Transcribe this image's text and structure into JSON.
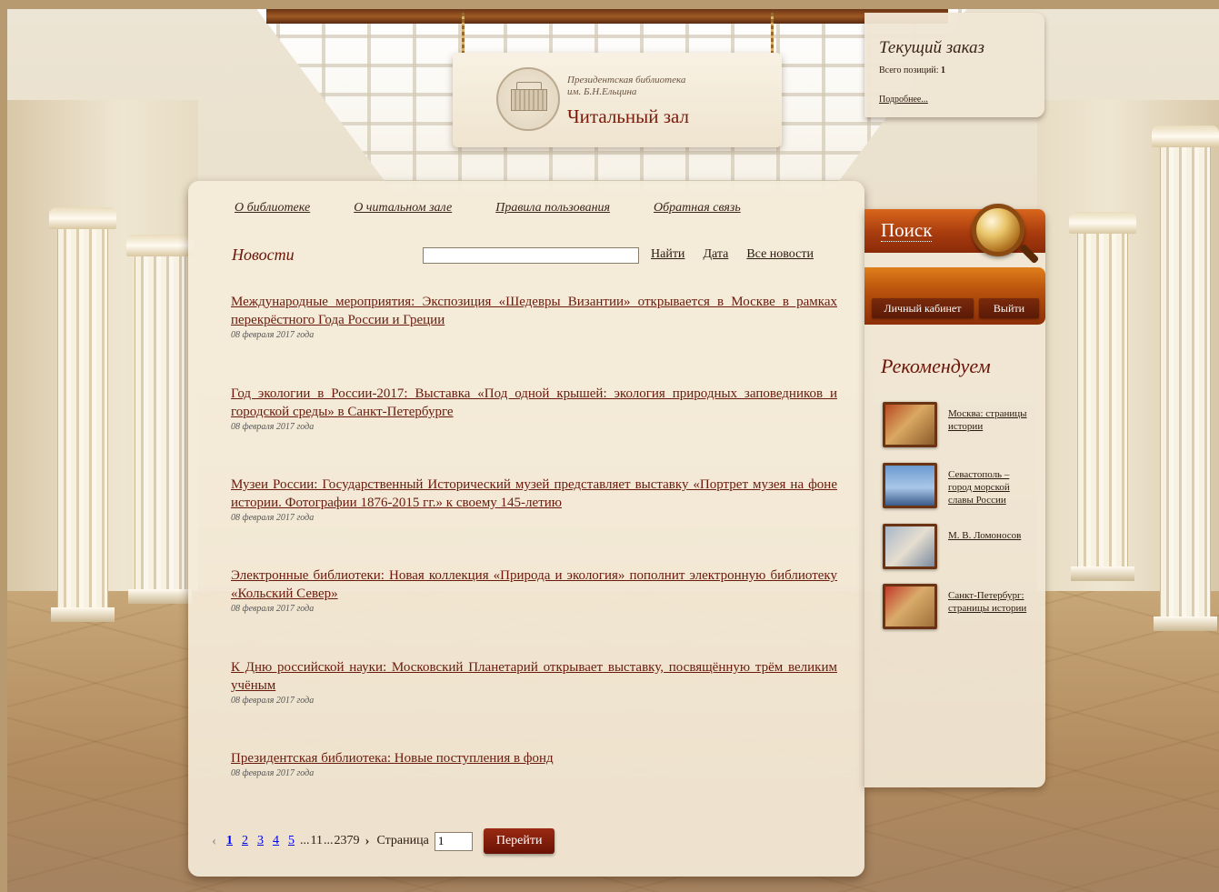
{
  "header": {
    "library_name_line1": "Президентская библиотека",
    "library_name_line2": "им. Б.Н.Ельцина",
    "section_title": "Читальный зал"
  },
  "order": {
    "title": "Текущий заказ",
    "count_label": "Всего позиций:",
    "count_value": "1",
    "more_link": "Подробнее..."
  },
  "topnav": [
    {
      "label": "О библиотеке"
    },
    {
      "label": "О читальном зале"
    },
    {
      "label": "Правила пользования"
    },
    {
      "label": "Обратная связь"
    }
  ],
  "news": {
    "heading": "Новости",
    "search_value": "",
    "find_label": "Найти",
    "date_label": "Дата",
    "all_label": "Все новости",
    "items": [
      {
        "title": "Международные мероприятия: Экспозиция «Шедевры Византии» открывается в Москве в рамках перекрёстного Года России и Греции",
        "date": "08 февраля 2017 года"
      },
      {
        "title": "Год экологии в России-2017: Выставка «Под одной крышей: экология природных заповедников и городской среды» в Санкт-Петербурге",
        "date": "08 февраля 2017 года"
      },
      {
        "title": "Музеи России: Государственный Исторический музей представляет выставку «Портрет музея на фоне истории. Фотографии 1876-2015 гг.» к своему 145-летию",
        "date": "08 февраля 2017 года"
      },
      {
        "title": "Электронные библиотеки: Новая коллекция «Природа и экология» пополнит электронную библиотеку «Кольский Север»",
        "date": "08 февраля 2017 года"
      },
      {
        "title": "К Дню российской науки: Московский Планетарий открывает выставку, посвящённую трём великим учёным",
        "date": "08 февраля 2017 года"
      },
      {
        "title": "Президентская библиотека: Новые поступления в фонд",
        "date": "08 февраля 2017 года"
      }
    ]
  },
  "pager": {
    "prev_icon": "‹",
    "pages": [
      "1",
      "2",
      "3",
      "4",
      "5"
    ],
    "current": "1",
    "dots": "...",
    "page_11": "11",
    "last_page": "2379",
    "next_icon": "›",
    "page_label": "Страница",
    "page_input_value": "1",
    "go_label": "Перейти"
  },
  "sidebar": {
    "search_label": "Поиск",
    "account_label": "Личный кабинет",
    "logout_label": "Выйти",
    "recommend_title": "Рекомендуем",
    "recommend": [
      {
        "label": "Москва: страницы истории"
      },
      {
        "label": "Севастополь – город морской славы России"
      },
      {
        "label": "М. В. Ломоносов"
      },
      {
        "label": "Санкт-Петербург: страницы истории"
      }
    ]
  }
}
